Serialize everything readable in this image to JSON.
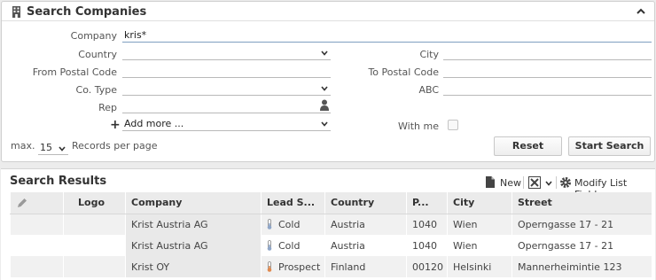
{
  "search_panel": {
    "title": "Search Companies",
    "fields": {
      "company": {
        "label": "Company",
        "value": "kris*"
      },
      "country": {
        "label": "Country",
        "value": ""
      },
      "city": {
        "label": "City",
        "value": ""
      },
      "from_postal": {
        "label": "From Postal Code",
        "value": ""
      },
      "to_postal": {
        "label": "To Postal Code",
        "value": ""
      },
      "co_type": {
        "label": "Co. Type",
        "value": ""
      },
      "abc": {
        "label": "ABC",
        "value": ""
      },
      "rep": {
        "label": "Rep",
        "value": ""
      },
      "add_more": {
        "value": "Add more ..."
      },
      "with_me": {
        "label": "With me"
      }
    },
    "max": {
      "label": "max.",
      "value": "15",
      "suffix": "Records per page"
    },
    "reset_label": "Reset",
    "start_label": "Start Search"
  },
  "results": {
    "title": "Search Results",
    "toolbar": {
      "new_label": "New",
      "modify_label": "Modify List Fields"
    },
    "columns": [
      "",
      "Logo",
      "Company",
      "Lead S...",
      "Country",
      "P...",
      "City",
      "Street"
    ],
    "rows": [
      {
        "company": "Krist Austria AG",
        "lead": "Cold",
        "lead_color": "#8fa6c8",
        "country": "Austria",
        "postal": "1040",
        "city": "Wien",
        "street": "Operngasse 17 - 21"
      },
      {
        "company": "Krist Austria AG",
        "lead": "Cold",
        "lead_color": "#8fa6c8",
        "country": "Austria",
        "postal": "1040",
        "city": "Wien",
        "street": "Operngasse 17 - 21"
      },
      {
        "company": "Krist OY",
        "lead": "Prospect",
        "lead_color": "#e0894f",
        "country": "Finland",
        "postal": "00120",
        "city": "Helsinki",
        "street": "Mannerheimintie 123"
      }
    ]
  }
}
